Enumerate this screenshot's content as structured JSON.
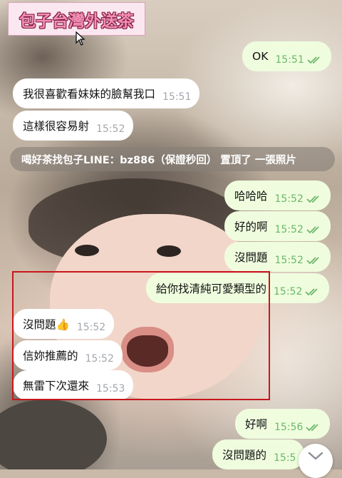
{
  "banner": {
    "text": "包子台灣外送茶"
  },
  "pinned": {
    "text": "喝好茶找包子LINE：bz886（保證秒回） 置頂了 一張照片"
  },
  "messages": [
    {
      "side": "out",
      "text": "OK",
      "time": "15:51",
      "read": true
    },
    {
      "side": "in",
      "text": "我很喜歡看妹妹的臉幫我口",
      "time": "15:51"
    },
    {
      "side": "in",
      "text": "這樣很容易射",
      "time": "15:52"
    },
    {
      "side": "out",
      "text": "哈哈哈",
      "time": "15:52",
      "read": true
    },
    {
      "side": "out",
      "text": "好的啊",
      "time": "15:52",
      "read": true
    },
    {
      "side": "out",
      "text": "沒問題",
      "time": "15:52",
      "read": true
    },
    {
      "side": "out",
      "text": "給你找清純可愛類型的",
      "time": "15:52",
      "read": true
    },
    {
      "side": "in",
      "text": "沒問題👍",
      "time": "15:52"
    },
    {
      "side": "in",
      "text": "信妳推薦的",
      "time": "15:52"
    },
    {
      "side": "in",
      "text": "無雷下次還來",
      "time": "15:53"
    },
    {
      "side": "out",
      "text": "好啊",
      "time": "15:56",
      "read": true
    },
    {
      "side": "out",
      "text": "沒問題的",
      "time": "15:5",
      "read": true
    }
  ],
  "colors": {
    "incoming_bubble": "#ffffff",
    "outgoing_bubble": "#effdde",
    "outgoing_time": "#6cb76a",
    "highlight_box": "#c8161d"
  },
  "icons": {
    "read_receipt": "double-check-icon",
    "scroll_down": "chevron-down-icon",
    "cursor": "mouse-pointer-icon"
  }
}
